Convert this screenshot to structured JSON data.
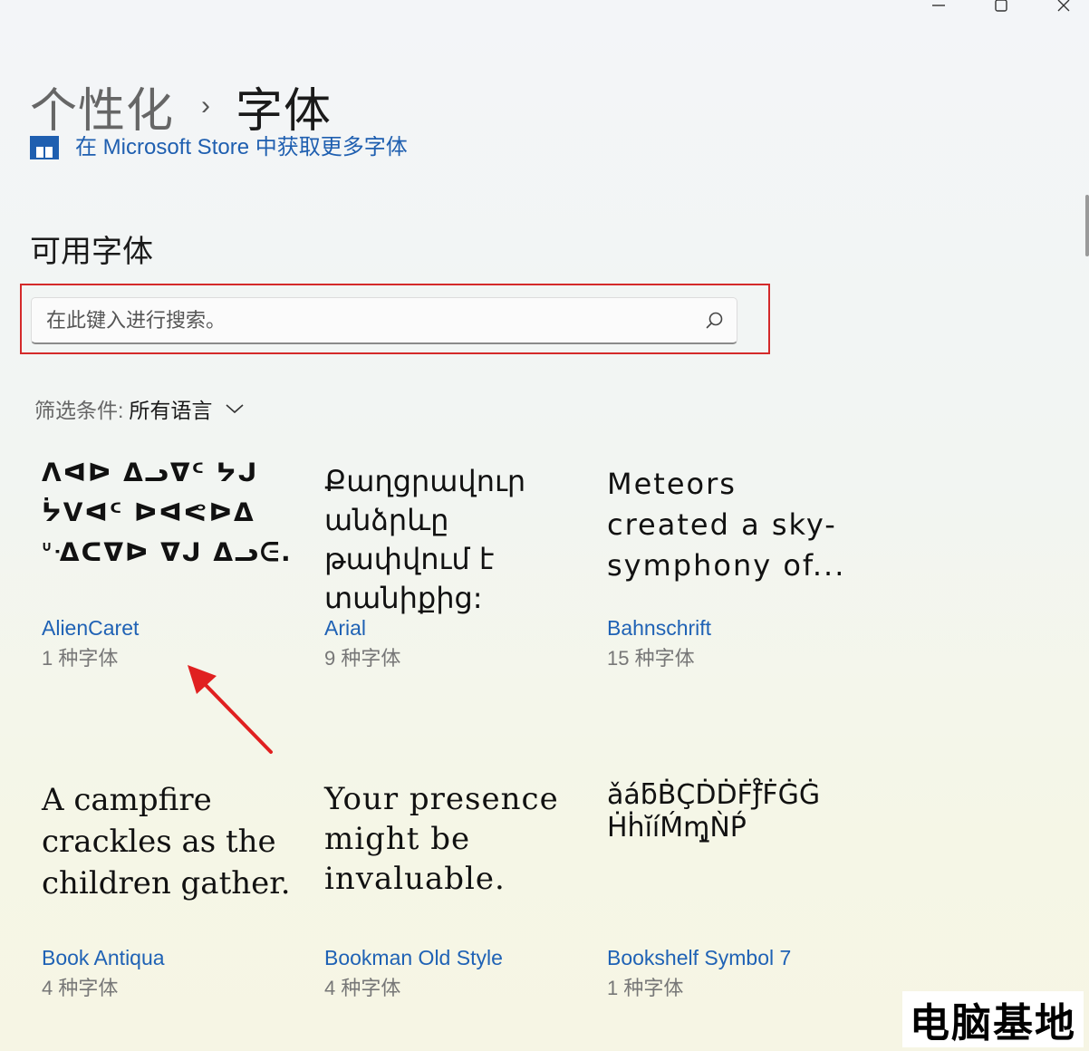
{
  "window": {
    "controls": {
      "minimize_icon": "minimize-icon",
      "maximize_icon": "maximize-icon",
      "close_icon": "close-icon"
    }
  },
  "breadcrumb": {
    "parent": "个性化",
    "separator": "›",
    "current": "字体"
  },
  "store_link": {
    "text": "在 Microsoft Store 中获取更多字体",
    "icon": "store-icon",
    "color": "#1f5fb0"
  },
  "section": {
    "title": "可用字体"
  },
  "search": {
    "placeholder": "在此键入进行搜索。",
    "value": "",
    "icon": "search-icon"
  },
  "filter": {
    "label": "筛选条件:",
    "value": "所有语言",
    "icon": "chevron-down-icon"
  },
  "fonts": [
    {
      "preview_lines": [
        "ᐱᐊᐅ ᐃᓗᐁᑦ ᔭᒍ",
        "ᔮᐯᐊᑦ ᐅᐊᕙᐅᐃ",
        "ᐡᐎᑕᐁᐅ ᐁᒍ ᐃᓗᕮ."
      ],
      "name": "AlienCaret",
      "count": "1 种字体"
    },
    {
      "preview_lines": [
        "Քաղցրավուր",
        "անձրևը",
        "թափվում է",
        "տանիքից:"
      ],
      "name": "Arial",
      "count": "9 种字体"
    },
    {
      "preview_lines": [
        "Meteors",
        "created a sky-",
        "symphony of..."
      ],
      "name": "Bahnschrift",
      "count": "15 种字体"
    },
    {
      "preview_lines": [
        "A campfire",
        "crackles as the",
        "children gather."
      ],
      "name": "Book Antiqua",
      "count": "4 种字体"
    },
    {
      "preview_lines": [
        "Your presence",
        "might be",
        "invaluable."
      ],
      "name": "Bookman Old Style",
      "count": "4 种字体"
    },
    {
      "preview_lines": [
        "ǎáƃḂÇḊḊḞƒ̊ḞĠĠ",
        "ḢḣĭíḾɱ̢ǸṔ"
      ],
      "name": "Bookshelf Symbol 7",
      "count": "1 种字体"
    }
  ],
  "annotation": {
    "arrow_color": "#e02020",
    "highlight_color": "#d42a2a"
  },
  "watermark": {
    "text": "电脑基地"
  }
}
